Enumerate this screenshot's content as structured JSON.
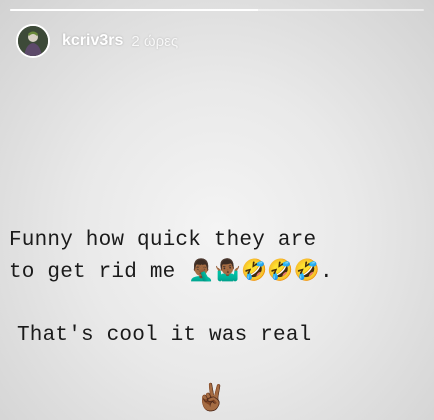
{
  "story": {
    "progress_fraction": 0.6,
    "user": {
      "username": "kcriv3rs",
      "time_ago": "2 ώρες"
    },
    "text_lines": {
      "line1": "Funny how quick they are",
      "line2_text": "to get rid me",
      "line2_emojis": "🤦🏾‍♂️🤷🏾‍♂️🤣🤣🤣",
      "line2_end": ".",
      "line3": "That's cool it was real"
    },
    "final_emoji": "✌🏾"
  },
  "colors": {
    "text": "#1a1a1a",
    "header_text": "#ffffff",
    "background": "#e9e9e9"
  }
}
